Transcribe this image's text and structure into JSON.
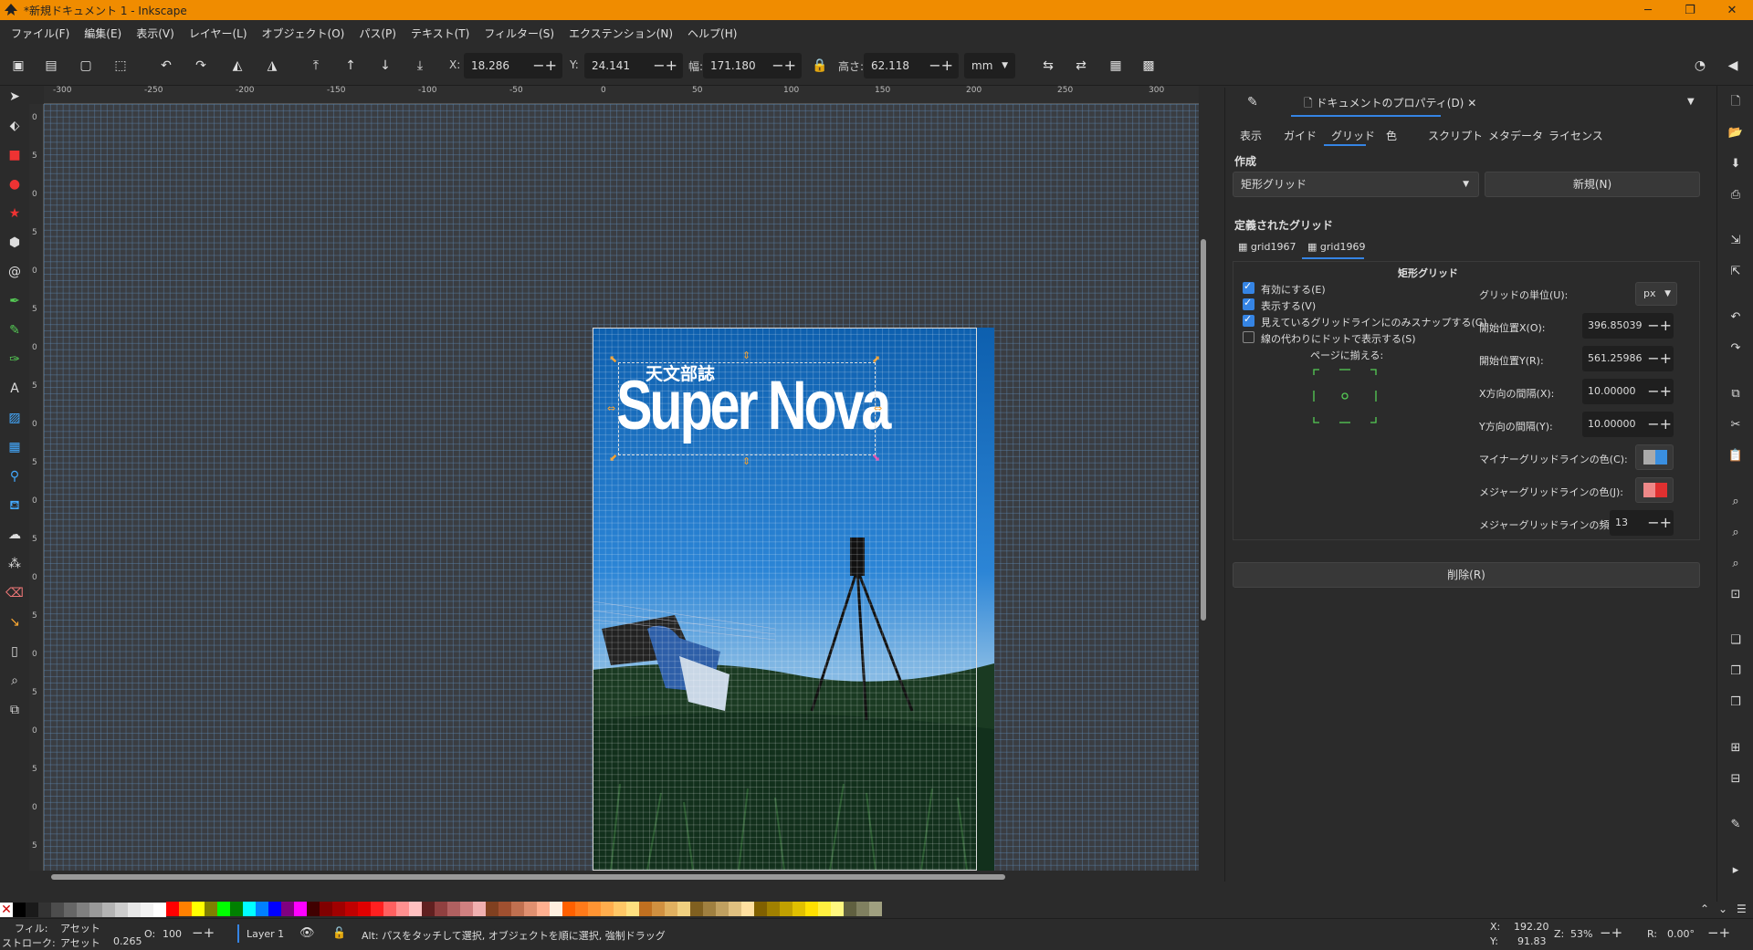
{
  "app": {
    "title": "*新規ドキュメント 1 - Inkscape"
  },
  "menu": [
    "ファイル(F)",
    "編集(E)",
    "表示(V)",
    "レイヤー(L)",
    "オブジェクト(O)",
    "パス(P)",
    "テキスト(T)",
    "フィルター(S)",
    "エクステンション(N)",
    "ヘルプ(H)"
  ],
  "toolbar": {
    "x_label": "X:",
    "x_value": "18.286",
    "y_label": "Y:",
    "y_value": "24.141",
    "w_label": "幅:",
    "w_value": "171.180",
    "h_label": "高さ:",
    "h_value": "62.118",
    "unit": "mm"
  },
  "ruler": {
    "h": [
      "-300",
      "-250",
      "-200",
      "-150",
      "-100",
      "-50",
      "0",
      "50",
      "100",
      "150",
      "200",
      "250",
      "300"
    ],
    "v": [
      "0",
      "5",
      "0",
      "5",
      "0",
      "5",
      "0",
      "5",
      "0",
      "5",
      "0",
      "5",
      "0",
      "5",
      "0",
      "5",
      "0",
      "5",
      "0",
      "5"
    ]
  },
  "artwork": {
    "subtitle": "天文部誌",
    "title": "Super Nova"
  },
  "panel": {
    "tab_doc": "ドキュメントのプロパティ(D)",
    "subtabs": [
      "表示",
      "ガイド",
      "グリッド",
      "色",
      "スクリプト",
      "メタデータ",
      "ライセンス"
    ],
    "create_label": "作成",
    "grid_type": "矩形グリッド",
    "new_button": "新規(N)",
    "defined_label": "定義されたグリッド",
    "grids": [
      "grid1967",
      "grid1969"
    ],
    "grid_heading": "矩形グリッド",
    "checks": [
      {
        "label": "有効にする(E)",
        "checked": true
      },
      {
        "label": "表示する(V)",
        "checked": true
      },
      {
        "label": "見えているグリッドラインにのみスナップする(G)",
        "checked": true
      },
      {
        "label": "線の代わりにドットで表示する(S)",
        "checked": false
      }
    ],
    "align_label": "ページに揃える:",
    "props": [
      {
        "label": "グリッドの単位(U):",
        "value": "px",
        "kind": "select"
      },
      {
        "label": "開始位置X(O):",
        "value": "396.85039",
        "kind": "spin"
      },
      {
        "label": "開始位置Y(R):",
        "value": "561.25986",
        "kind": "spin"
      },
      {
        "label": "X方向の間隔(X):",
        "value": "10.00000",
        "kind": "spin"
      },
      {
        "label": "Y方向の間隔(Y):",
        "value": "10.00000",
        "kind": "spin"
      },
      {
        "label": "マイナーグリッドラインの色(C):",
        "value": "",
        "kind": "color",
        "color": "#3a8fe0"
      },
      {
        "label": "メジャーグリッドラインの色(J):",
        "value": "",
        "kind": "color",
        "color": "#e03030"
      },
      {
        "label": "メジャーグリッドラインの頻度(M):",
        "value": "13",
        "kind": "spin"
      }
    ],
    "delete_button": "削除(R)"
  },
  "palette": [
    "#ff0000",
    "#ff8000",
    "#ffff00",
    "#808000",
    "#00ff00",
    "#008000",
    "#00ffff",
    "#0080ff",
    "#0000ff",
    "#800080",
    "#ff00ff",
    "#400000",
    "#800000",
    "#a00000",
    "#c00000",
    "#e00000",
    "#ff2020",
    "#ff6060",
    "#ff9090",
    "#ffc0c0",
    "#602020",
    "#904040",
    "#b06060",
    "#d08080",
    "#f0b0b0",
    "#804020",
    "#a05030",
    "#c07050",
    "#e09070",
    "#ffb090",
    "#fff0e0",
    "#ff6000",
    "#ff7a1a",
    "#ff9433",
    "#ffad4d",
    "#ffc766",
    "#ffe080",
    "#c07020",
    "#d09040",
    "#e0b060",
    "#f0d080",
    "#806020",
    "#a08040",
    "#c0a060",
    "#e0c080",
    "#ffe0a0",
    "#806000",
    "#a08000",
    "#c0a000",
    "#e0c000",
    "#ffe000",
    "#fff040",
    "#fff880",
    "#606040",
    "#808060",
    "#a0a080"
  ],
  "status": {
    "fill_label": "フィル:",
    "fill_value": "アセット",
    "stroke_label": "ストローク:",
    "stroke_value": "アセット",
    "stroke_width": "0.265",
    "opacity_label": "O:",
    "opacity_value": "100",
    "layer": "Layer 1",
    "message": "Alt: パスをタッチして選択, オブジェクトを順に選択, 強制ドラッグ",
    "cx_label": "X:",
    "cx_value": "192.20",
    "cy_label": "Y:",
    "cy_value": "91.83",
    "zoom_label": "Z:",
    "zoom_value": "53%",
    "rot_label": "R:",
    "rot_value": "0.00°"
  }
}
